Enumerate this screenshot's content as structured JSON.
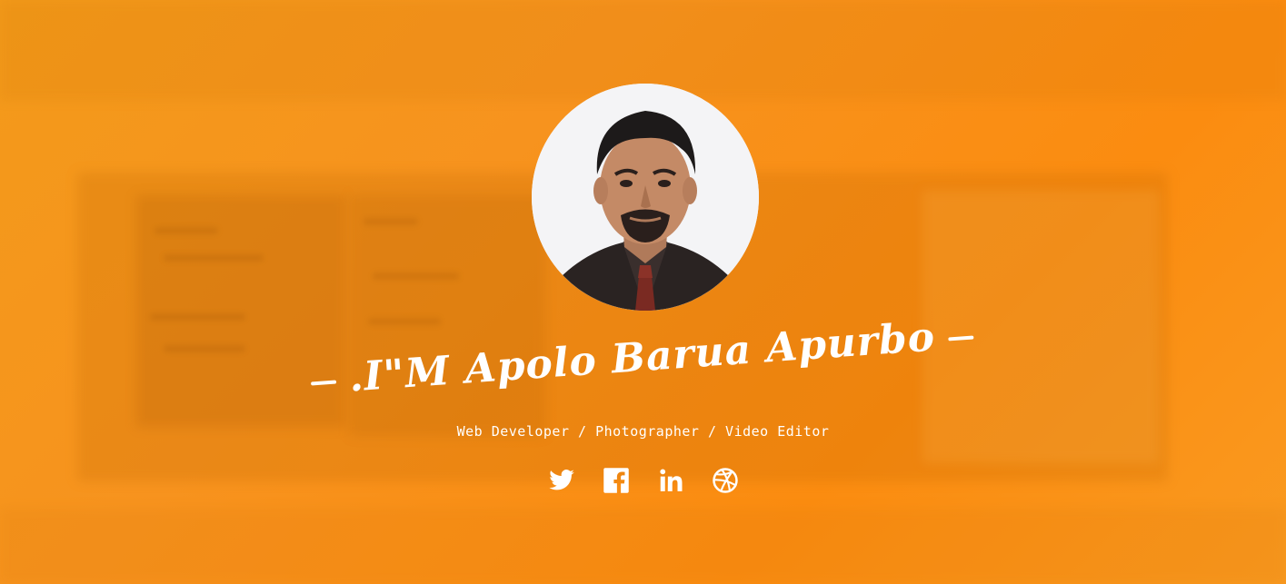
{
  "profile": {
    "name": ".I\"M Apolo Barua Apurbo",
    "roles": "Web Developer / Photographer / Video Editor",
    "avatar_alt": "Profile photo"
  },
  "social": [
    {
      "icon": "twitter-icon"
    },
    {
      "icon": "facebook-icon"
    },
    {
      "icon": "linkedin-icon"
    },
    {
      "icon": "dribbble-icon"
    }
  ],
  "colors": {
    "background": "#f7931e",
    "text": "#ffffff"
  }
}
